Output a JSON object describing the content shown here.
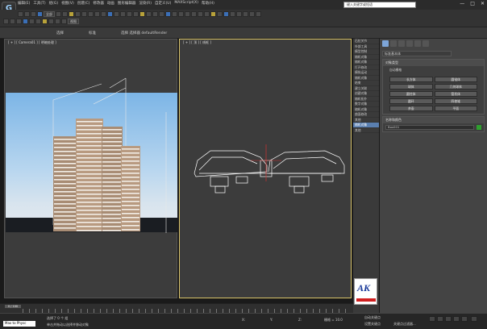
{
  "app": {
    "logo_letter": "G"
  },
  "menu": [
    "编辑(E)",
    "工具(T)",
    "组(G)",
    "视图(V)",
    "创建(C)",
    "修改器",
    "动画",
    "图形编辑器",
    "渲染(R)",
    "自定义(U)",
    "MAXScript(X)",
    "帮助(H)"
  ],
  "search": {
    "placeholder": "键入关键字或短语"
  },
  "window_controls": [
    "—",
    "□",
    "✕"
  ],
  "toolbar": {
    "selection_filter": "全部",
    "view_dropdown": "视图"
  },
  "ribbon": {
    "labels": [
      "选择",
      "标准",
      "选择 选择器 defaultRender"
    ]
  },
  "viewports": {
    "perspective": {
      "label": "[ + ] [ Camera01 ] [ 明暗处理 ]"
    },
    "top": {
      "label": "[ + ] [ 顶 ] [ 线框 ]"
    }
  },
  "cmd_strip": [
    "石拉关节",
    "外部工具",
    "模型控制",
    "随机对象",
    "随机对象",
    "打开修改",
    "模拟运动",
    "随机对象",
    "结束",
    "建立关联",
    "创建对象",
    "随机拓扑",
    "数字对象",
    "随机对象",
    "曲面修改",
    "其他",
    "随机对象",
    "其他"
  ],
  "cmd_panel": {
    "dropdown": "标准基本体",
    "rollout_object_type": "对象类型",
    "auto_grid": "自动栅格",
    "buttons": [
      "长方体",
      "圆锥体",
      "球体",
      "几何球体",
      "圆柱体",
      "管状体",
      "圆环",
      "四棱锥",
      "茶壶",
      "平面"
    ],
    "rollout_name_color": "名称和颜色",
    "object_name": "Box001"
  },
  "ak_logo": {
    "text": "AK"
  },
  "timeline": {
    "frame": "0 / 100"
  },
  "status": {
    "maxscript": "Max to Physc",
    "line1": "选择了 0 个 组",
    "line2": "单击并拖动以选择并移动对象",
    "x_label": "X:",
    "y_label": "Y:",
    "z_label": "Z:",
    "grid": "栅格 = 10.0",
    "autokey": "自动关键点",
    "setkey": "设置关键点",
    "keyfilter": "关键点过滤器..."
  },
  "colors": {
    "active_border": "#d8c36a",
    "sky_top": "#7cb5e6",
    "selected_tab": "#5a7fb0",
    "logo_blue": "#1a3a9a",
    "logo_red": "#d02020"
  }
}
